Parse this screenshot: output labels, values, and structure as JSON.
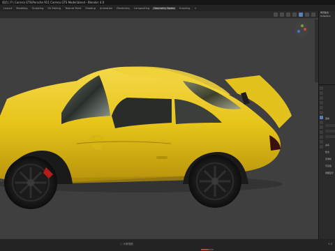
{
  "window": {
    "title": "项目 | F:\\ Carrera GTS\\Porsche 911 Carrera GTS Model.blend - Blender 4.0"
  },
  "menubar": {
    "items": [
      "Layout",
      "Modeling",
      "Sculpting",
      "UV Editing",
      "Texture Paint",
      "Shading",
      "Animation",
      "Rendering",
      "Compositing",
      "Geometry Nodes",
      "Scripting",
      "+"
    ]
  },
  "outliner": {
    "rows": [
      "场景集合",
      "Collection",
      "",
      "",
      ""
    ]
  },
  "properties": {
    "labels": [
      "变换",
      "位置",
      "旋转",
      "缩放",
      "关系",
      "集合",
      "实例化",
      "可见性",
      "视图显示"
    ]
  },
  "statusbar": {
    "left": "",
    "center": "○  平移视图",
    "right": "4.0",
    "progress": 0.6
  },
  "colors": {
    "car_body": "#e6c419",
    "viewport_bg": "#3f3f3f",
    "accent": "#5680c2"
  }
}
